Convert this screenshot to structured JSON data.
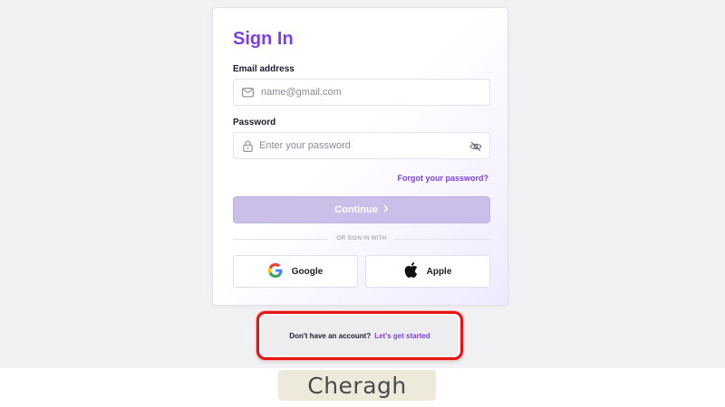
{
  "signin": {
    "title": "Sign In",
    "email_label": "Email address",
    "email_placeholder": "name@gmail.com",
    "email_value": "",
    "password_label": "Password",
    "password_placeholder": "Enter your password",
    "password_value": "",
    "forgot_link": "Forgot your password?",
    "continue_label": "Continue",
    "divider_text": "OR SIGN IN WITH",
    "google_label": "Google",
    "apple_label": "Apple"
  },
  "signup": {
    "question": "Don't have an account?",
    "link": "Let's get started"
  },
  "watermark": {
    "text": "Cheragh"
  },
  "colors": {
    "accent": "#7b3fe4",
    "button_disabled": "#cbbfea",
    "highlight_border": "#e61414",
    "page_bg": "#f1f1f3"
  },
  "icons": {
    "email": "envelope-icon",
    "password": "lock-icon",
    "toggle_visibility": "eye-off-icon",
    "continue": "chevron-right-icon",
    "google": "google-icon",
    "apple": "apple-icon"
  }
}
